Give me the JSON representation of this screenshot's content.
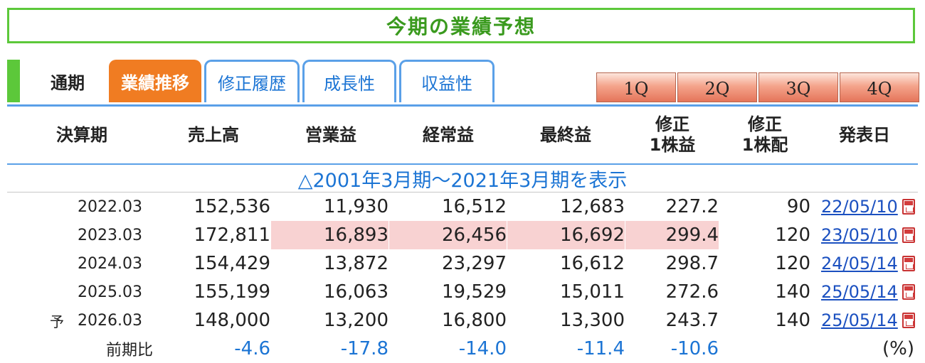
{
  "title": "今期の業績予想",
  "tabs": {
    "static": "通期",
    "active": "業績推移",
    "others": [
      "修正履歴",
      "成長性",
      "収益性"
    ]
  },
  "quarters": [
    "1Q",
    "2Q",
    "3Q",
    "4Q"
  ],
  "headers": {
    "period": "決算期",
    "sales": "売上高",
    "operating": "営業益",
    "ordinary": "経常益",
    "net": "最終益",
    "eps_line1": "修正",
    "eps_line2": "1株益",
    "dps_line1": "修正",
    "dps_line2": "1株配",
    "date": "発表日"
  },
  "history_link": "△2001年3月期～2021年3月期を表示",
  "rows": [
    {
      "prefix": "",
      "period": "2022.03",
      "sales": "152,536",
      "operating": "11,930",
      "ordinary": "16,512",
      "net": "12,683",
      "eps": "227.2",
      "dps": "90",
      "date": "22/05/10"
    },
    {
      "prefix": "",
      "period": "2023.03",
      "sales": "172,811",
      "operating": "16,893",
      "ordinary": "26,456",
      "net": "16,692",
      "eps": "299.4",
      "dps": "120",
      "date": "23/05/10"
    },
    {
      "prefix": "",
      "period": "2024.03",
      "sales": "154,429",
      "operating": "13,872",
      "ordinary": "23,297",
      "net": "16,612",
      "eps": "298.7",
      "dps": "120",
      "date": "24/05/14"
    },
    {
      "prefix": "",
      "period": "2025.03",
      "sales": "155,199",
      "operating": "16,063",
      "ordinary": "19,529",
      "net": "15,011",
      "eps": "272.6",
      "dps": "140",
      "date": "25/05/14"
    },
    {
      "prefix": "予",
      "period": "2026.03",
      "sales": "148,000",
      "operating": "13,200",
      "ordinary": "16,800",
      "net": "13,300",
      "eps": "243.7",
      "dps": "140",
      "date": "25/05/14"
    }
  ],
  "comparison": {
    "label": "前期比",
    "sales": "-4.6",
    "operating": "-17.8",
    "ordinary": "-14.0",
    "net": "-11.4",
    "eps": "-10.6",
    "unit": "(%)"
  },
  "colors": {
    "green": "#5cc83a",
    "orange_tab": "#f07c22",
    "blue_border": "#5aa0e8",
    "link_blue": "#1b74d4",
    "highlight": "#f8d2d2"
  }
}
